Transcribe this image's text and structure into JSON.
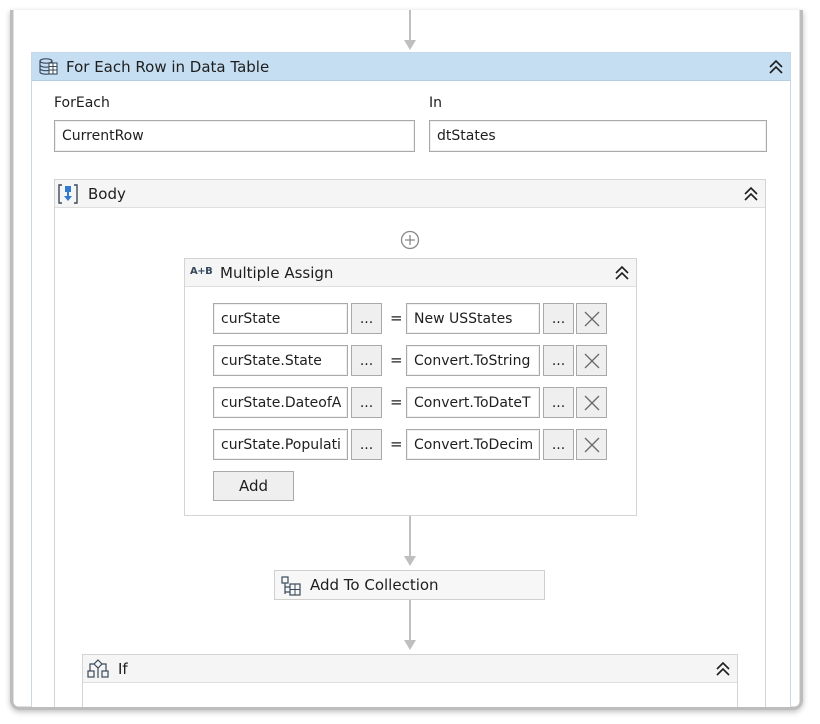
{
  "foreach_activity": {
    "title": "For Each Row in Data Table",
    "foreach_label": "ForEach",
    "foreach_value": "CurrentRow",
    "in_label": "In",
    "in_value": "dtStates",
    "icon": "data-table-icon",
    "collapse_icon": "double-chevron-up-icon"
  },
  "body_scope": {
    "title": "Body",
    "icon": "body-sequence-icon",
    "add_icon": "plus-circle-icon"
  },
  "multiple_assign": {
    "title": "Multiple Assign",
    "icon_text": "A+B",
    "rows": [
      {
        "left": "curState",
        "right": "New USStates"
      },
      {
        "left": "curState.State",
        "right": "Convert.ToString"
      },
      {
        "left": "curState.DateofA",
        "right": "Convert.ToDateT"
      },
      {
        "left": "curState.Populati",
        "right": "Convert.ToDecim"
      }
    ],
    "dots_label": "...",
    "equals": "=",
    "add_label": "Add"
  },
  "add_to_collection": {
    "title": "Add To Collection",
    "icon": "add-to-collection-icon"
  },
  "if_activity": {
    "title": "If",
    "icon": "if-branch-icon"
  },
  "colors": {
    "header_blue": "#c6def1",
    "border": "#a9a9a9",
    "arrow": "#bfbfbf"
  }
}
